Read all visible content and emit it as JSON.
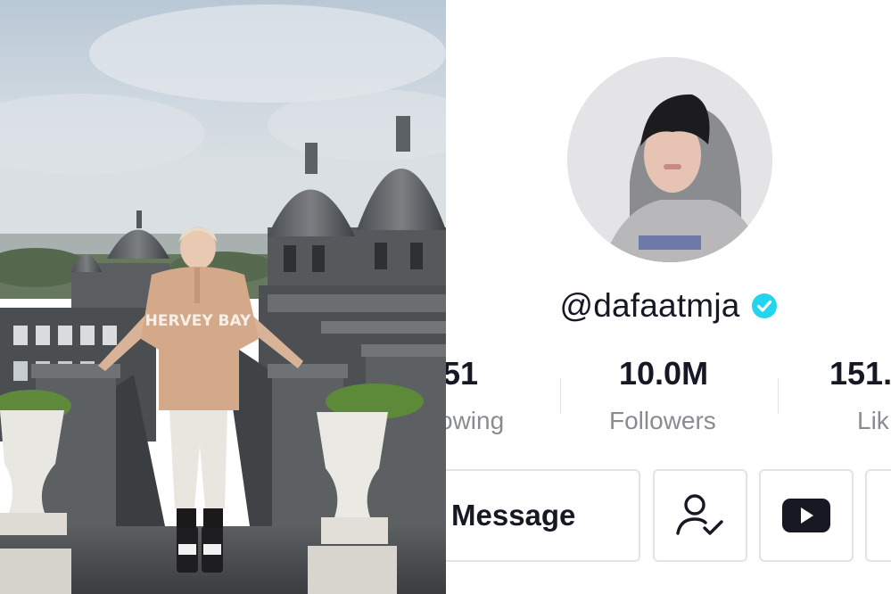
{
  "profile": {
    "username": "@dafaatmja",
    "verified": true,
    "stats": [
      {
        "value": "51",
        "label": "owing"
      },
      {
        "value": "10.0M",
        "label": "Followers"
      },
      {
        "value": "151.",
        "label": "Lik"
      }
    ],
    "buttons": {
      "message_label": "Message",
      "follow_status_icon": "user-check-icon",
      "youtube_icon": "youtube-icon"
    }
  },
  "photo": {
    "sweatshirt_text": "HERVEY BAY"
  },
  "colors": {
    "text_primary": "#161823",
    "text_secondary": "#8a8b91",
    "verified_blue": "#20d5ec",
    "border": "#e3e3e4"
  }
}
